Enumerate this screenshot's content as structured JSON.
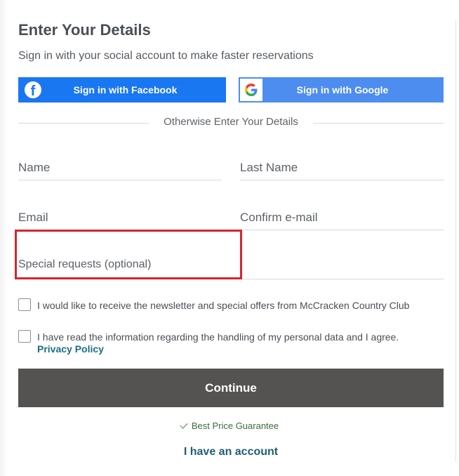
{
  "form": {
    "title": "Enter Your Details",
    "subtitle": "Sign in with your social account to make faster reservations",
    "social": {
      "facebook_label": "Sign in with Facebook",
      "google_label": "Sign in with Google",
      "facebook_color": "#1a77f2",
      "google_color": "#4d8def"
    },
    "divider_text": "Otherwise Enter Your Details",
    "fields": {
      "name_placeholder": "Name",
      "last_name_placeholder": "Last Name",
      "email_placeholder": "Email",
      "confirm_email_placeholder": "Confirm e-mail",
      "special_requests_placeholder": "Special requests (optional)"
    },
    "checkboxes": {
      "newsletter_label": "I would like to receive the newsletter and special offers from McCracken Country Club",
      "newsletter_checked": false,
      "privacy_label": "I have read the information regarding the handling of my personal data and I agree.",
      "privacy_checked": false,
      "privacy_link": "Privacy Policy"
    },
    "continue_label": "Continue",
    "guarantee_text": "Best Price Guarantee",
    "account_link": "I have an account",
    "highlight_color": "#d3262c"
  }
}
